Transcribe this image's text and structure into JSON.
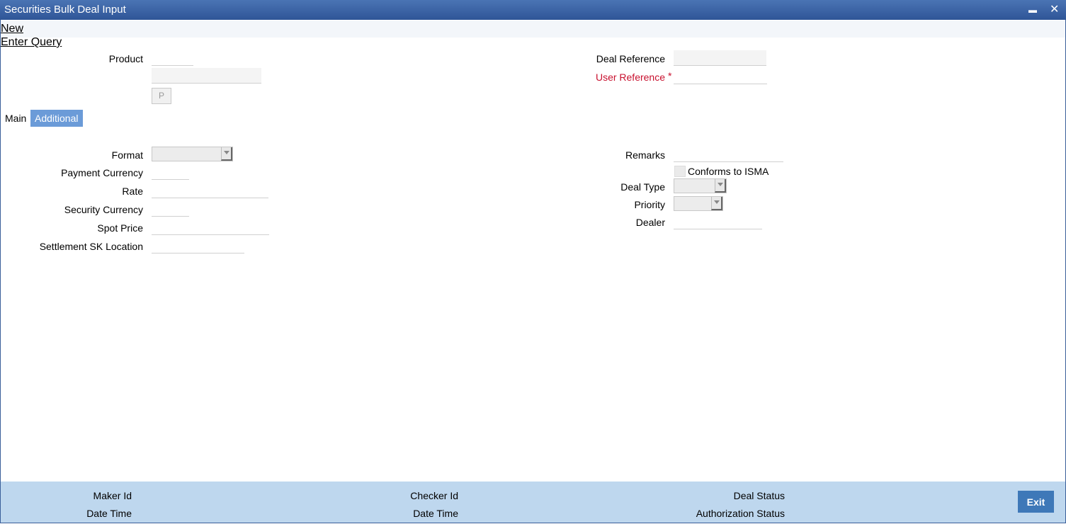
{
  "window": {
    "title": "Securities Bulk Deal Input",
    "minimize": "▬",
    "close": "✕"
  },
  "menu": {
    "new": "New",
    "enter_query": "Enter Query"
  },
  "header": {
    "product_label": "Product",
    "product_button": "P",
    "deal_reference_label": "Deal Reference",
    "user_reference_label": "User Reference",
    "required_mark": "*"
  },
  "tabs": [
    {
      "label": "Main"
    },
    {
      "label": "Additional"
    }
  ],
  "form_left": {
    "format_label": "Format",
    "payment_currency_label": "Payment Currency",
    "rate_label": "Rate",
    "security_currency_label": "Security Currency",
    "spot_price_label": "Spot Price",
    "settlement_sk_location_label": "Settlement SK Location"
  },
  "form_right": {
    "remarks_label": "Remarks",
    "conforms_isma_label": "Conforms to ISMA",
    "deal_type_label": "Deal Type",
    "priority_label": "Priority",
    "dealer_label": "Dealer"
  },
  "footer": {
    "maker_id": "Maker Id",
    "date_time_1": "Date Time",
    "checker_id": "Checker Id",
    "date_time_2": "Date Time",
    "deal_status": "Deal Status",
    "authorization_status": "Authorization Status",
    "exit": "Exit"
  },
  "colors": {
    "title_bar": "#2f5597",
    "active_tab": "#6b9bd8",
    "footer": "#bed7ee",
    "required": "#c8102e",
    "exit_button": "#3e78b8"
  }
}
